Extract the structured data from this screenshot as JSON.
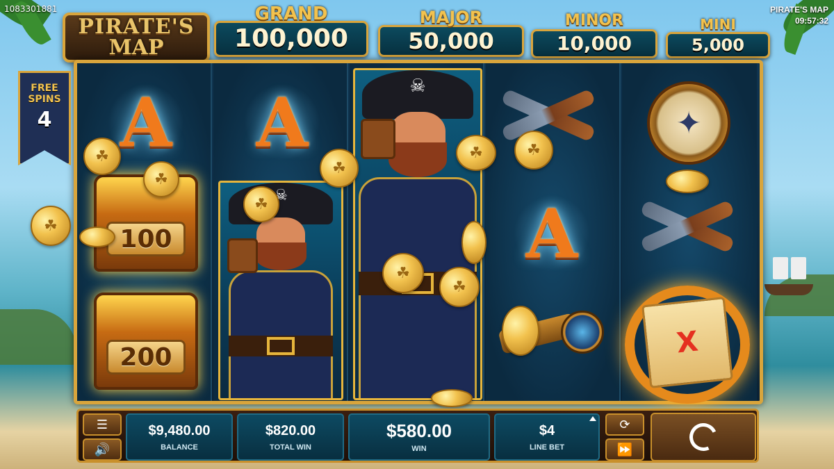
{
  "header": {
    "session_id": "1083301881",
    "game_name": "PIRATE'S MAP",
    "clock": "09:57:32"
  },
  "logo": {
    "line1": "PIRATE'S",
    "line2": "MAP"
  },
  "jackpots": [
    {
      "label": "GRAND",
      "value": "100,000"
    },
    {
      "label": "MAJOR",
      "value": "50,000"
    },
    {
      "label": "MINOR",
      "value": "10,000"
    },
    {
      "label": "MINI",
      "value": "5,000"
    }
  ],
  "free_spins": {
    "label": "FREE SPINS",
    "count": "4"
  },
  "reels": {
    "symbol_a": "A",
    "chest_values": [
      "100",
      "200"
    ],
    "map_mark": "X",
    "compass_glyph": "✦",
    "coin_glyph": "☘",
    "skull_glyph": "☠"
  },
  "bottom_bar": {
    "balance": {
      "value": "$9,480.00",
      "label": "BALANCE"
    },
    "total_win": {
      "value": "$820.00",
      "label": "TOTAL WIN"
    },
    "win": {
      "value": "$580.00",
      "label": "WIN"
    },
    "line_bet": {
      "value": "$4",
      "label": "LINE BET"
    },
    "icons": [
      "menu-icon",
      "sound-icon",
      "autoplay-icon",
      "turbo-icon",
      "spin-icon",
      "bet-up-icon"
    ]
  },
  "colors": {
    "gold": "#d9a53c",
    "panel": "#0d4a62",
    "reel_bg": "#0f3450"
  }
}
